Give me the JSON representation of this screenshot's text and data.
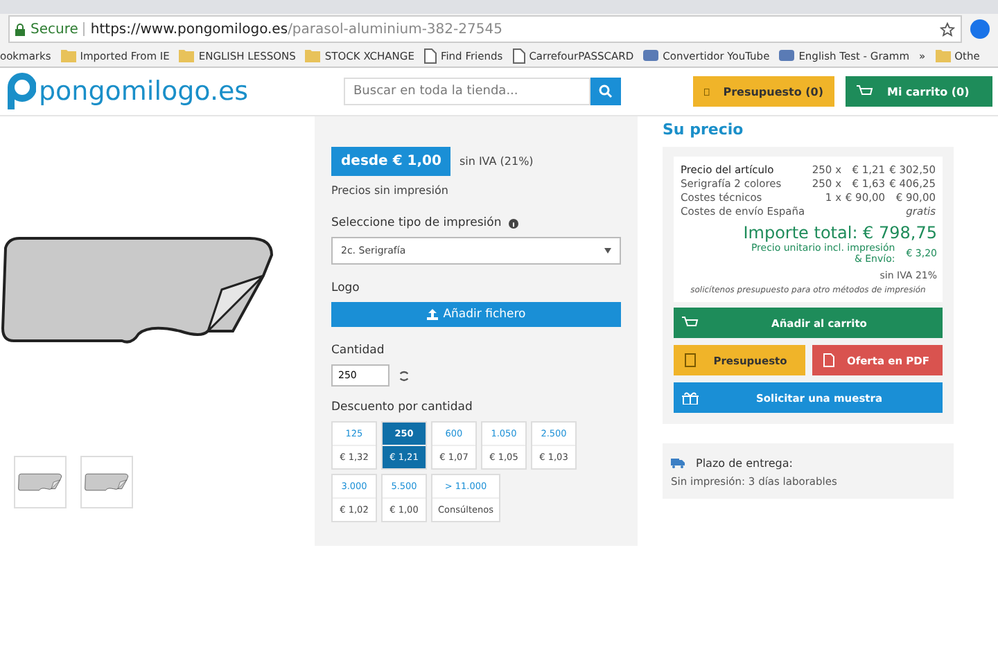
{
  "browser": {
    "secure_label": "Secure",
    "url_host": "https://www.pongomilogo.es",
    "url_path": "/parasol-aluminium-382-27545"
  },
  "bookmarks": [
    {
      "kind": "text",
      "label": "ookmarks"
    },
    {
      "kind": "folder",
      "label": "Imported From IE"
    },
    {
      "kind": "folder",
      "label": "ENGLISH LESSONS"
    },
    {
      "kind": "folder",
      "label": "STOCK XCHANGE"
    },
    {
      "kind": "page",
      "label": "Find Friends"
    },
    {
      "kind": "page",
      "label": "CarrefourPASSCARD"
    },
    {
      "kind": "app",
      "label": "Convertidor YouTube"
    },
    {
      "kind": "app",
      "label": "English Test - Gramm"
    },
    {
      "kind": "text",
      "label": "»"
    },
    {
      "kind": "folder",
      "label": "Othe"
    }
  ],
  "header": {
    "logo": "pongomilogo.es",
    "search_placeholder": "Buscar en toda la tienda...",
    "quote_button": "Presupuesto (0)",
    "cart_button": "Mi carrito (0)"
  },
  "config": {
    "price_badge": "desde € 1,00",
    "tax_note": "sin IVA (21%)",
    "price_note": "Precios sin impresión",
    "print_type_label": "Seleccione tipo de impresión",
    "print_type_value": "2c. Serigrafía",
    "logo_label": "Logo",
    "upload_button": "Añadir fichero",
    "quantity_label": "Cantidad",
    "quantity": "250",
    "discount_label": "Descuento por cantidad",
    "tiers": [
      {
        "qty": "125",
        "price": "€ 1,32",
        "selected": false
      },
      {
        "qty": "250",
        "price": "€ 1,21",
        "selected": true
      },
      {
        "qty": "600",
        "price": "€ 1,07",
        "selected": false
      },
      {
        "qty": "1.050",
        "price": "€ 1,05",
        "selected": false
      },
      {
        "qty": "2.500",
        "price": "€ 1,03",
        "selected": false
      },
      {
        "qty": "3.000",
        "price": "€ 1,02",
        "selected": false
      },
      {
        "qty": "5.500",
        "price": "€ 1,00",
        "selected": false
      },
      {
        "qty": "> 11.000",
        "price": "Consúltenos",
        "selected": false
      }
    ]
  },
  "price": {
    "heading": "Su precio",
    "lines": [
      {
        "label": "Precio del artículo",
        "qty": "250 x",
        "unit": "€ 1,21",
        "total": "€ 302,50"
      },
      {
        "label": "Serigrafía 2 colores",
        "qty": "250 x",
        "unit": "€ 1,63",
        "total": "€ 406,25"
      },
      {
        "label": "Costes técnicos",
        "qty": "1 x",
        "unit": "€ 90,00",
        "total": "€ 90,00"
      },
      {
        "label": "Costes de envío España",
        "total": "gratis"
      }
    ],
    "total": "Importe total: € 798,75",
    "unit_price_label": "Precio unitario incl. impresión & Envío:",
    "unit_price": "€ 3,20",
    "vat_note": "sin IVA 21%",
    "other_methods_note": "solicítenos presupuesto para otro métodos de impresión",
    "buttons": [
      {
        "kind": "cart",
        "label": "Añadir al carrito"
      },
      {
        "kind": "quote",
        "label": "Presupuesto"
      },
      {
        "kind": "pdf",
        "label": "Oferta en PDF"
      },
      {
        "kind": "sample",
        "label": "Solicitar una muestra"
      }
    ]
  },
  "delivery": {
    "title": "Plazo de entrega:",
    "text": "Sin impresión: 3 días laborables"
  }
}
